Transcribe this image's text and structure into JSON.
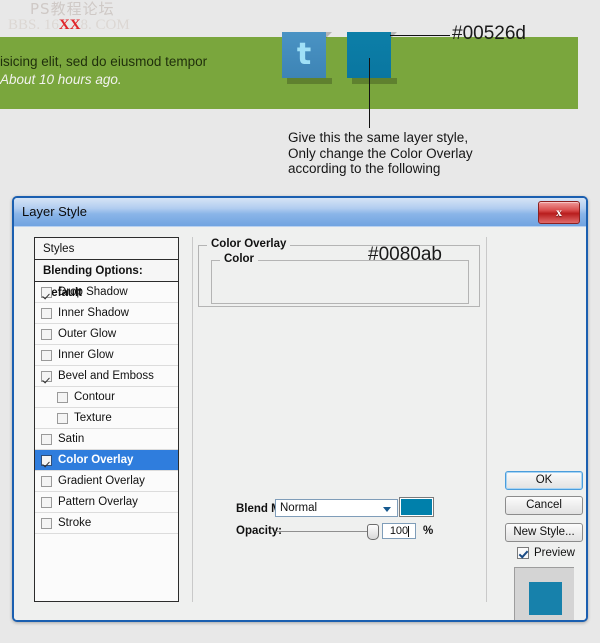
{
  "watermark": {
    "line1": "PS教程论坛",
    "line2_prefix": "BBS. 16",
    "line2_hot": "XX",
    "line2_suffix": "8. COM"
  },
  "banner": {
    "line1": "isicing elit, sed do eiusmod tempor",
    "line2": "About 10 hours ago.",
    "background_color": "#7aa63d",
    "twitter_glyph": "t"
  },
  "callouts": {
    "hex_label": "#00526d",
    "note": "Give this the same layer style,\nOnly change the Color Overlay\naccording to the following",
    "note_line1": "Give this the same layer style,",
    "note_line2": "Only change the Color Overlay",
    "note_line3": "according to the following"
  },
  "dialog": {
    "title": "Layer Style",
    "close_glyph": "x",
    "styles_panel": {
      "header": "Styles",
      "blending_options": "Blending Options: Default",
      "effects": [
        {
          "label": "Drop Shadow",
          "checked": true,
          "indented": false,
          "selected": false
        },
        {
          "label": "Inner Shadow",
          "checked": false,
          "indented": false,
          "selected": false
        },
        {
          "label": "Outer Glow",
          "checked": false,
          "indented": false,
          "selected": false
        },
        {
          "label": "Inner Glow",
          "checked": false,
          "indented": false,
          "selected": false
        },
        {
          "label": "Bevel and Emboss",
          "checked": true,
          "indented": false,
          "selected": false
        },
        {
          "label": "Contour",
          "checked": false,
          "indented": true,
          "selected": false
        },
        {
          "label": "Texture",
          "checked": false,
          "indented": true,
          "selected": false
        },
        {
          "label": "Satin",
          "checked": false,
          "indented": false,
          "selected": false
        },
        {
          "label": "Color Overlay",
          "checked": true,
          "indented": false,
          "selected": true
        },
        {
          "label": "Gradient Overlay",
          "checked": false,
          "indented": false,
          "selected": false
        },
        {
          "label": "Pattern Overlay",
          "checked": false,
          "indented": false,
          "selected": false
        },
        {
          "label": "Stroke",
          "checked": false,
          "indented": false,
          "selected": false
        }
      ]
    },
    "color_overlay": {
      "group_title": "Color Overlay",
      "color_group_title": "Color",
      "hex_annotation": "#0080ab",
      "blend_mode_label": "Blend Mode:",
      "blend_mode_value": "Normal",
      "swatch_color": "#0080ab",
      "opacity_label": "Opacity:",
      "opacity_value": "100",
      "opacity_unit": "%"
    },
    "buttons": {
      "ok": "OK",
      "cancel": "Cancel",
      "new_style": "New Style...",
      "preview": "Preview"
    }
  }
}
